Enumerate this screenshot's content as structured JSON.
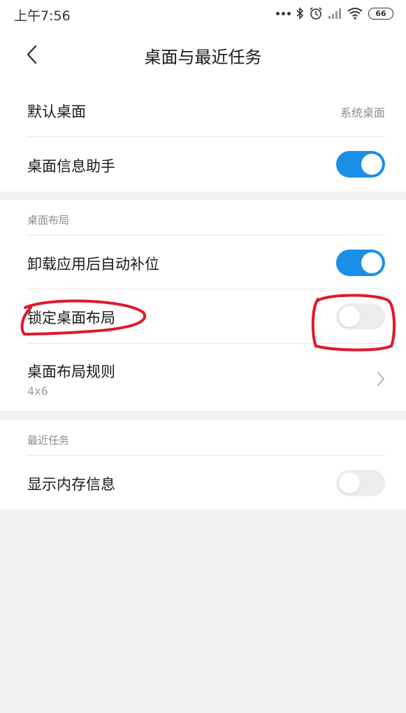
{
  "status_bar": {
    "time": "上午7:56",
    "battery": "66"
  },
  "header": {
    "title": "桌面与最近任务"
  },
  "general": {
    "default_desktop": {
      "label": "默认桌面",
      "value": "系统桌面"
    },
    "desktop_assistant": {
      "label": "桌面信息助手",
      "enabled": true
    }
  },
  "layout_section": {
    "title": "桌面布局",
    "auto_fill": {
      "label": "卸载应用后自动补位",
      "enabled": true
    },
    "lock_layout": {
      "label": "锁定桌面布局",
      "enabled": false
    },
    "layout_rule": {
      "label": "桌面布局规则",
      "value": "4x6"
    }
  },
  "recent_section": {
    "title": "最近任务",
    "show_memory": {
      "label": "显示内存信息",
      "enabled": false
    }
  },
  "colors": {
    "toggle_on": "#1a8fe8",
    "toggle_off": "#ececec",
    "annotation": "#e0182b"
  }
}
